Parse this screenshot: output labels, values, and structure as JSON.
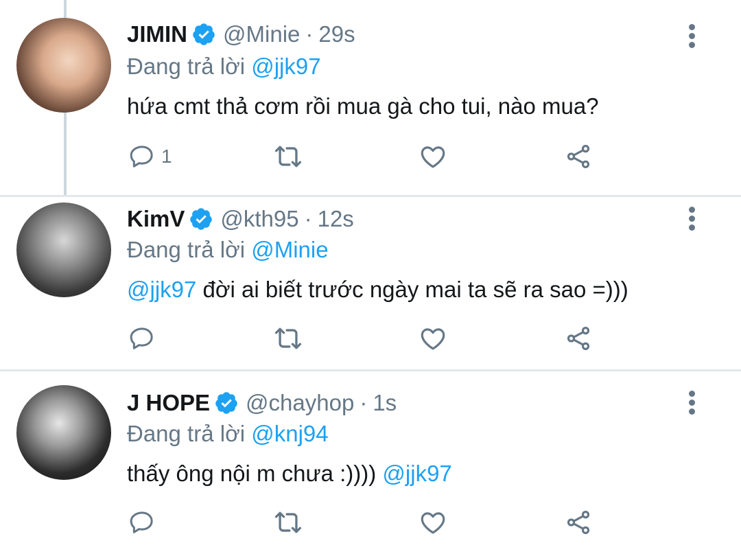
{
  "tweets": [
    {
      "name": "JIMIN",
      "handle": "@Minie",
      "time": "29s",
      "reply_label": "Đang trả lời",
      "reply_to": "@jjk97",
      "text_plain": "hứa cmt thả cơm rồi mua gà cho tui, nào mua?",
      "reply_count": "1"
    },
    {
      "name": "KimV",
      "handle": "@kth95",
      "time": "12s",
      "reply_label": "Đang trả lời",
      "reply_to": "@Minie",
      "text_mention": "@jjk97",
      "text_plain": " đời ai biết trước ngày mai ta sẽ ra sao =)))",
      "reply_count": ""
    },
    {
      "name": "J HOPE",
      "handle": "@chayhop",
      "time": "1s",
      "reply_label": "Đang trả lời",
      "reply_to": "@knj94",
      "text_plain": "thấy ông nội m chưa :)))) ",
      "text_mention": "@jjk97",
      "reply_count": ""
    }
  ],
  "separator": "·",
  "icons": {
    "verified": "verified-badge-icon",
    "reply": "reply-bubble-icon",
    "retweet": "retweet-icon",
    "like": "heart-icon",
    "share": "share-icon",
    "more": "more-vertical-icon"
  },
  "colors": {
    "accent": "#1da1f2",
    "secondary_text": "#657786",
    "primary_text": "#14171a",
    "divider": "#e1e8ed"
  }
}
